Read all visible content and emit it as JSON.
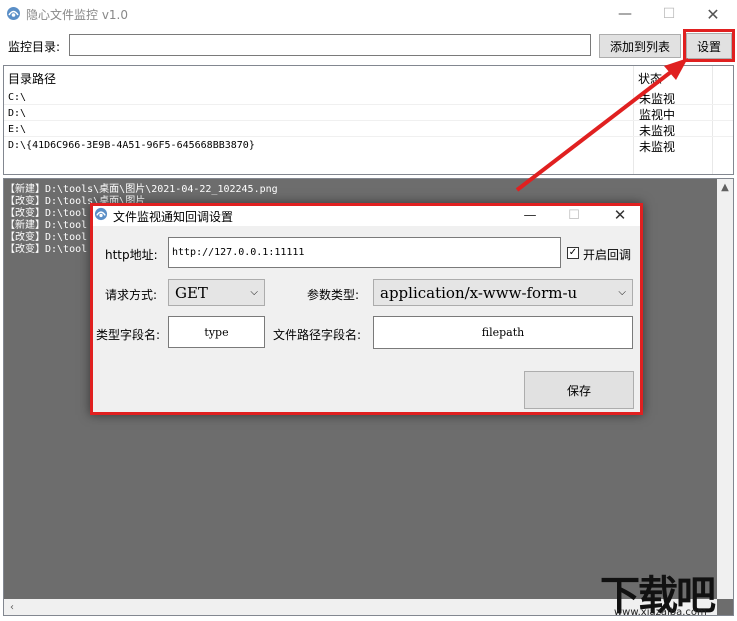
{
  "window": {
    "title": "隐心文件监控 v1.0",
    "min_glyph": "—",
    "max_glyph": "☐",
    "close_glyph": "✕"
  },
  "toolbar": {
    "dir_label": "监控目录:",
    "dir_value": "",
    "add_label": "添加到列表",
    "settings_label": "设置"
  },
  "list": {
    "headers": [
      "目录路径",
      "状态"
    ],
    "rows": [
      {
        "path": "C:\\",
        "status": "未监视"
      },
      {
        "path": "D:\\",
        "status": "监视中"
      },
      {
        "path": "E:\\",
        "status": "未监视"
      },
      {
        "path": "D:\\{41D6C966-3E9B-4A51-96F5-645668BB3870}",
        "status": "未监视"
      }
    ]
  },
  "log": {
    "lines": [
      "【新建】D:\\tools\\桌面\\图片\\2021-04-22_102245.png",
      "【改变】D:\\tools\\桌面\\图片",
      "【改变】D:\\tool",
      "【新建】D:\\tool",
      "【改变】D:\\tool",
      "【改变】D:\\tool"
    ]
  },
  "dialog": {
    "title": "文件监视通知回调设置",
    "http_label": "http地址:",
    "http_value": "http://127.0.0.1:11111",
    "callback_label": "开启回调",
    "callback_checked": true,
    "method_label": "请求方式:",
    "method_value": "GET",
    "param_type_label": "参数类型:",
    "param_type_value": "application/x-www-form-u",
    "type_field_label": "类型字段名:",
    "type_field_value": "type",
    "path_field_label": "文件路径字段名:",
    "path_field_value": "filepath",
    "save_label": "保存"
  },
  "watermark": {
    "mark": "下载吧",
    "url": "www.xiazaiba.com"
  },
  "colors": {
    "highlight": "#e02020",
    "log_bg": "#6d6d6d"
  }
}
